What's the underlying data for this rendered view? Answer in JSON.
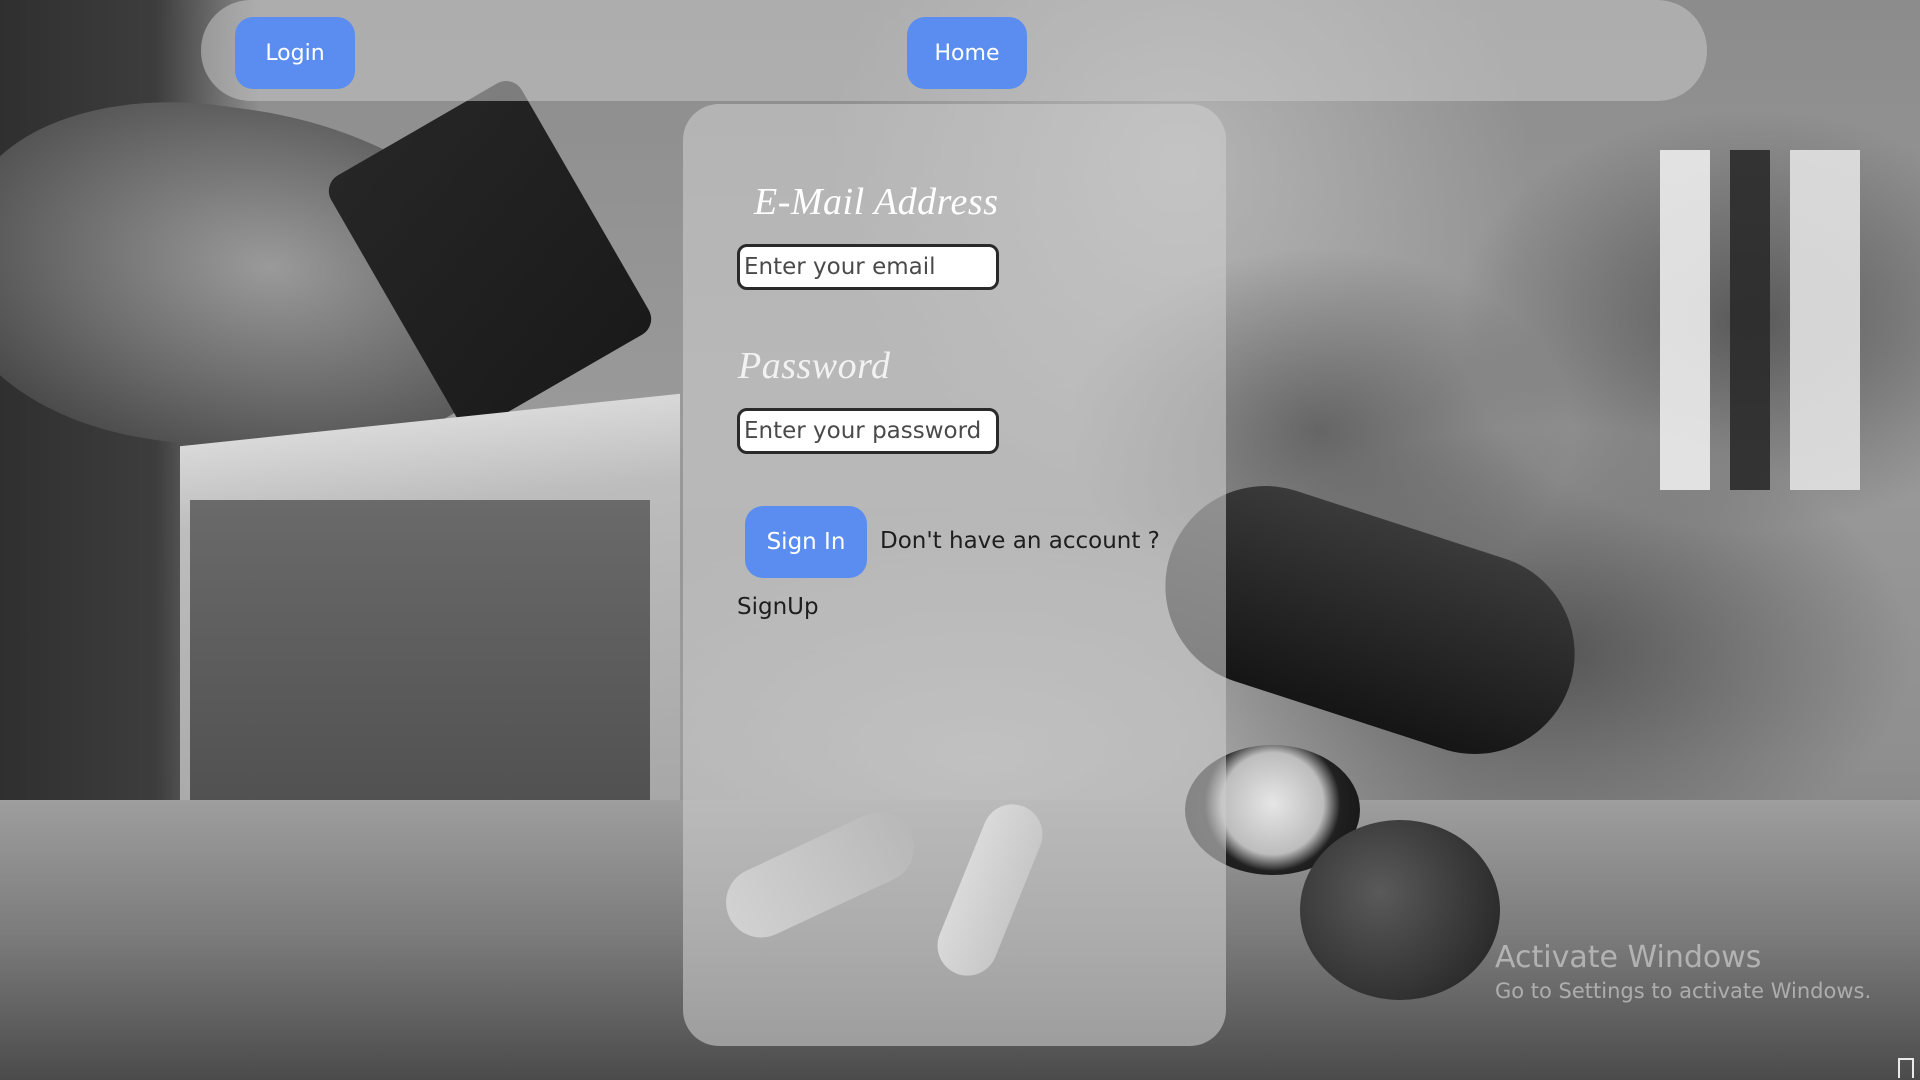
{
  "nav": {
    "login_label": "Login",
    "home_label": "Home"
  },
  "form": {
    "email_label": "E-Mail Address",
    "email_placeholder": "Enter your email",
    "password_label": "Password",
    "password_placeholder": "Enter your password",
    "signin_label": "Sign In",
    "no_account_text": "Don't have an account ?",
    "signup_label": "SignUp"
  },
  "watermark": {
    "title": "Activate Windows",
    "subtitle": "Go to Settings to activate Windows."
  },
  "colors": {
    "button_accent": "#5b8df0",
    "label_text": "#ffffff",
    "body_text": "#1e1e1e"
  },
  "icons": {
    "corner": "window-corner-icon"
  }
}
